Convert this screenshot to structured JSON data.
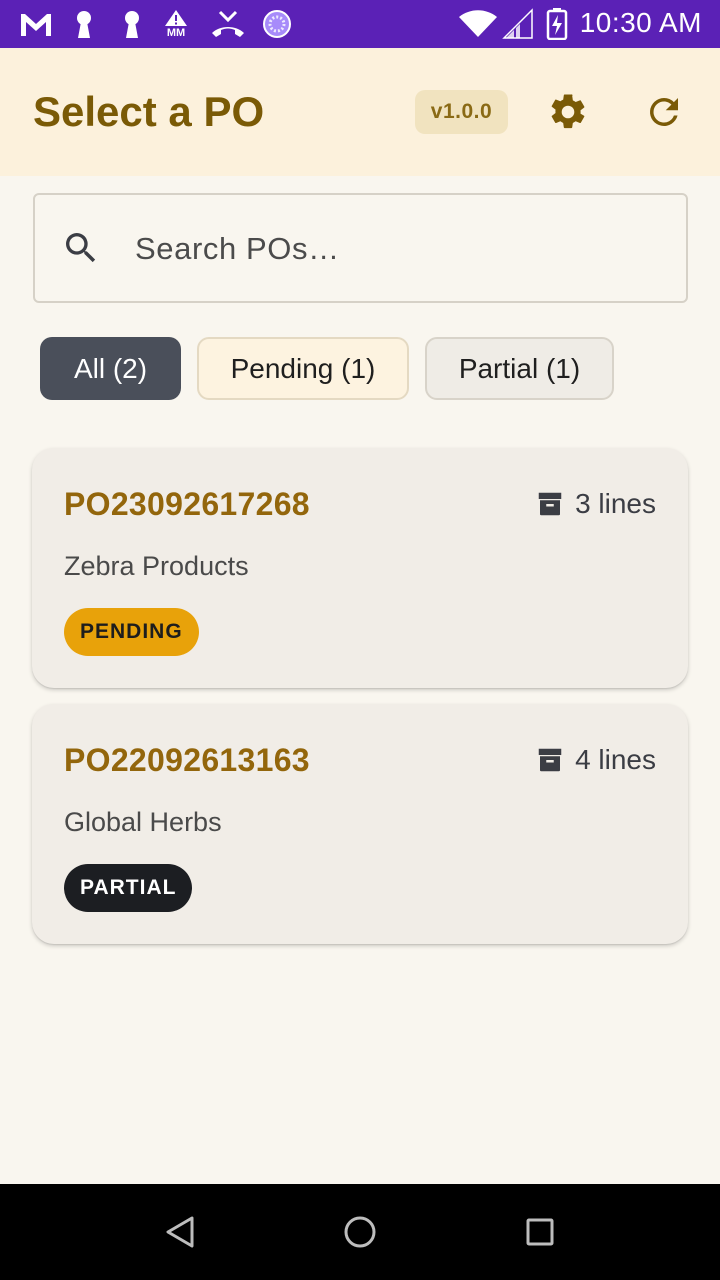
{
  "status_bar": {
    "time": "10:30 AM",
    "icons": [
      "gmail-icon",
      "keyhole-icon",
      "keyhole-icon",
      "warning-mm-icon",
      "missed-call-icon",
      "sync-circle-icon",
      "wifi-icon",
      "signal-icon",
      "battery-charging-icon"
    ],
    "mm_label": "MM"
  },
  "app_bar": {
    "title": "Select a PO",
    "version": "v1.0.0",
    "actions": [
      "settings-icon",
      "refresh-icon"
    ]
  },
  "search": {
    "placeholder": "Search POs…",
    "value": ""
  },
  "filters": [
    {
      "label": "All (2)",
      "selected": true
    },
    {
      "label": "Pending (1)",
      "selected": false
    },
    {
      "label": "Partial (1)",
      "selected": false
    }
  ],
  "orders": [
    {
      "po_number": "PO23092617268",
      "lines": "3 lines",
      "vendor": "Zebra Products",
      "status": "PENDING"
    },
    {
      "po_number": "PO22092613163",
      "lines": "4 lines",
      "vendor": "Global Herbs",
      "status": "PARTIAL"
    }
  ],
  "colors": {
    "status_bar": "#5b21b6",
    "app_bar": "#fcf1dc",
    "title": "#7a5a06",
    "po_number": "#93660c",
    "pending_badge": "#e8a20a",
    "partial_badge": "#1c1e22",
    "chip_selected": "#4a4f5a",
    "background": "#f9f6ef"
  }
}
